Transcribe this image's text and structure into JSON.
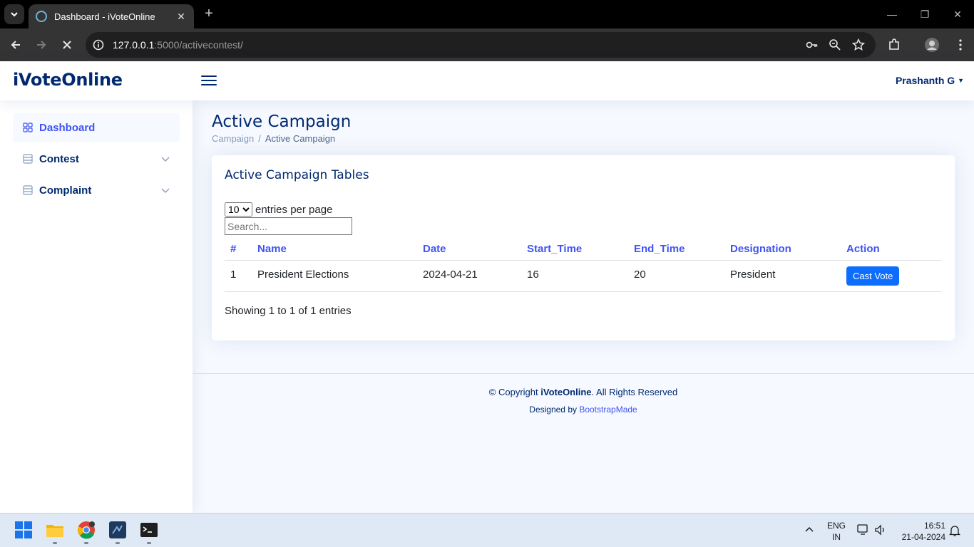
{
  "browser": {
    "tab_title": "Dashboard - iVoteOnline",
    "url_host": "127.0.0.1",
    "url_rest": ":5000/activecontest/"
  },
  "app": {
    "logo": "iVoteOnline",
    "user_name": "Prashanth G"
  },
  "sidebar": {
    "items": [
      {
        "label": "Dashboard",
        "icon": "grid-icon",
        "active": true
      },
      {
        "label": "Contest",
        "icon": "menu-icon",
        "expandable": true
      },
      {
        "label": "Complaint",
        "icon": "menu-icon",
        "expandable": true
      }
    ]
  },
  "page": {
    "title": "Active Campaign",
    "breadcrumb": [
      "Campaign",
      "Active Campaign"
    ]
  },
  "card": {
    "title": "Active Campaign Tables",
    "per_page_value": "10",
    "per_page_label": "entries per page",
    "search_placeholder": "Search...",
    "columns": [
      "#",
      "Name",
      "Date",
      "Start_Time",
      "End_Time",
      "Designation",
      "Action"
    ],
    "rows": [
      {
        "num": "1",
        "name": "President Elections",
        "date": "2024-04-21",
        "start": "16",
        "end": "20",
        "designation": "President",
        "action": "Cast Vote"
      }
    ],
    "info": "Showing 1 to 1 of 1 entries"
  },
  "footer": {
    "copyright_prefix": "© Copyright ",
    "copyright_brand": "iVoteOnline",
    "copyright_suffix": ". All Rights Reserved",
    "designed_by": "Designed by ",
    "designer": "BootstrapMade"
  },
  "taskbar": {
    "lang_top": "ENG",
    "lang_bottom": "IN",
    "time": "16:51",
    "date": "21-04-2024"
  },
  "colors": {
    "accent": "#4154f1",
    "navy": "#012970",
    "button": "#0d6efd"
  }
}
